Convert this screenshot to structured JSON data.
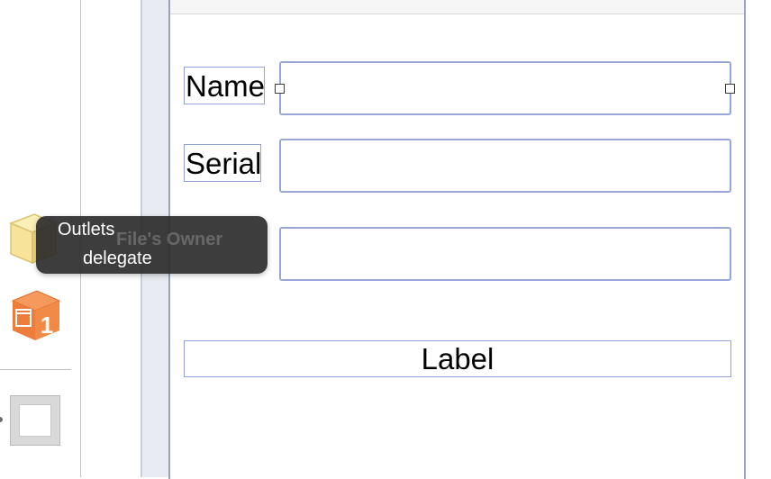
{
  "outline": {
    "files_owner_icon": "cube-icon",
    "view_controller_icon": "view-controller-icon",
    "view_controller_badge": "1",
    "view_icon": "view-icon"
  },
  "tooltip": {
    "ghost_text": "File's Owner",
    "line1": "Outlets",
    "line2": "delegate"
  },
  "form": {
    "name_label": "Name",
    "serial_label": "Serial",
    "name_value": "",
    "serial_value": "",
    "third_value": "",
    "bottom_label": "Label"
  },
  "colors": {
    "selection_outline": "#95a2d6",
    "tooltip_bg": "#282828",
    "view_controller_orange": "#f07a3a"
  }
}
